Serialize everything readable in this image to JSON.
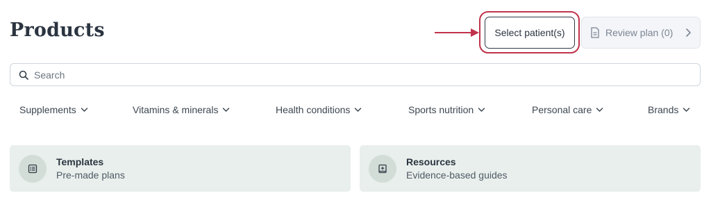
{
  "header": {
    "title": "Products",
    "select_patients_label": "Select patient(s)",
    "review_plan_label": "Review plan (0)"
  },
  "search": {
    "placeholder": "Search",
    "value": ""
  },
  "categories": [
    {
      "label": "Supplements"
    },
    {
      "label": "Vitamins & minerals"
    },
    {
      "label": "Health conditions"
    },
    {
      "label": "Sports nutrition"
    },
    {
      "label": "Personal care"
    },
    {
      "label": "Brands"
    }
  ],
  "cards": [
    {
      "title": "Templates",
      "subtitle": "Pre-made plans",
      "icon": "list-icon"
    },
    {
      "title": "Resources",
      "subtitle": "Evidence-based guides",
      "icon": "book-icon"
    }
  ],
  "colors": {
    "highlight": "#c0334b",
    "card_bg": "#e9efec",
    "icon_circle": "#d3ddd7"
  }
}
